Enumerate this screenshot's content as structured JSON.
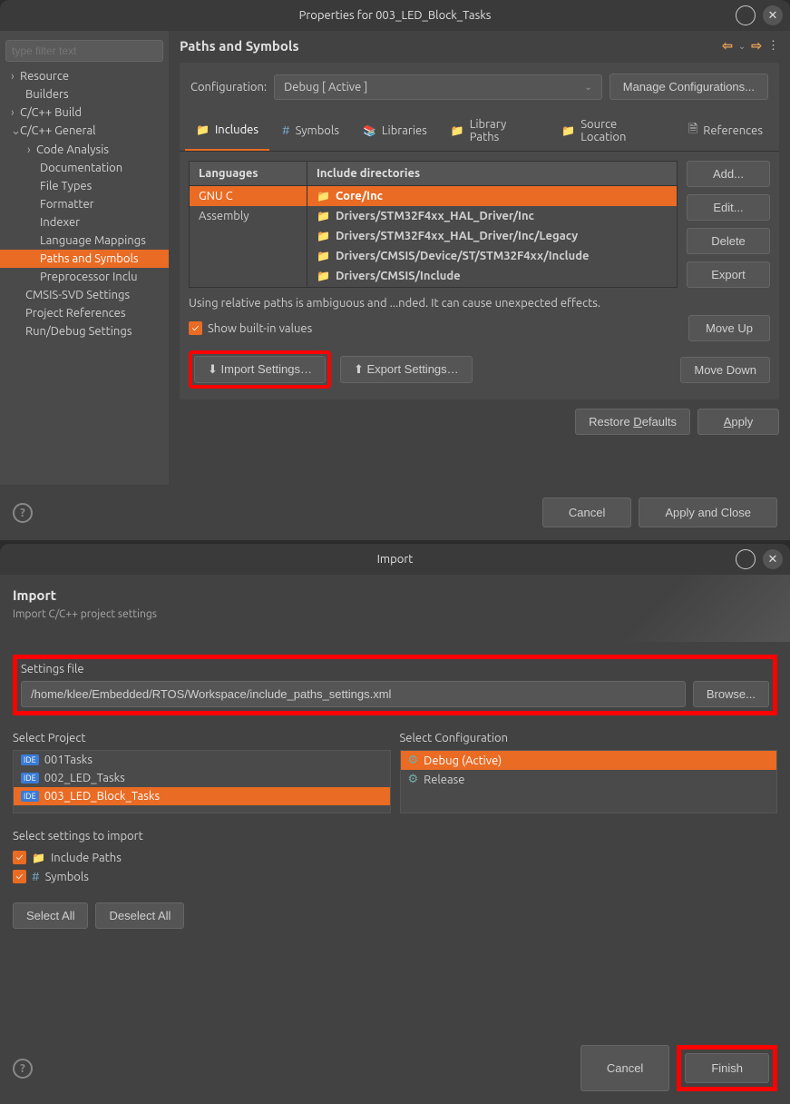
{
  "props": {
    "title": "Properties for 003_LED_Block_Tasks",
    "filter_placeholder": "type filter text",
    "tree": {
      "resource": "Resource",
      "builders": "Builders",
      "cbuild": "C/C++ Build",
      "cgeneral": "C/C++ General",
      "code_analysis": "Code Analysis",
      "documentation": "Documentation",
      "file_types": "File Types",
      "formatter": "Formatter",
      "indexer": "Indexer",
      "lang_mapping": "Language Mappings",
      "paths_symbols": "Paths and Symbols",
      "preproc": "Preprocessor Inclu",
      "cmsis": "CMSIS-SVD Settings",
      "proj_refs": "Project References",
      "rundebug": "Run/Debug Settings"
    },
    "section": "Paths and Symbols",
    "config_label": "Configuration:",
    "config_value": "Debug  [ Active ]",
    "manage_config": "Manage Configurations...",
    "tabs": {
      "includes": "Includes",
      "symbols": "Symbols",
      "libraries": "Libraries",
      "library_paths": "Library Paths",
      "source_location": "Source Location",
      "references": "References"
    },
    "table": {
      "lang_header": "Languages",
      "inc_header": "Include directories",
      "langs": [
        "GNU C",
        "Assembly"
      ],
      "includes": [
        "Core/Inc",
        "Drivers/STM32F4xx_HAL_Driver/Inc",
        "Drivers/STM32F4xx_HAL_Driver/Inc/Legacy",
        "Drivers/CMSIS/Device/ST/STM32F4xx/Include",
        "Drivers/CMSIS/Include"
      ]
    },
    "buttons": {
      "add": "Add...",
      "edit": "Edit...",
      "delete": "Delete",
      "export": "Export",
      "moveup": "Move Up",
      "movedown": "Move Down",
      "import_settings": "Import Settings…",
      "export_settings": "Export Settings…",
      "restore": "Restore Defaults",
      "apply": "Apply",
      "cancel": "Cancel",
      "apply_close": "Apply and Close"
    },
    "hint": "Using relative paths is ambiguous and ...nded. It can cause unexpected effects.",
    "show_builtin": "Show built-in values"
  },
  "import": {
    "title": "Import",
    "heading": "Import",
    "sub": "Import C/C++ project settings",
    "settings_file_label": "Settings file",
    "settings_file_value": "/home/klee/Embedded/RTOS/Workspace/include_paths_settings.xml",
    "browse": "Browse...",
    "select_project": "Select Project",
    "select_config": "Select Configuration",
    "projects": [
      "001Tasks",
      "002_LED_Tasks",
      "003_LED_Block_Tasks"
    ],
    "configs": [
      "Debug (Active)",
      "Release"
    ],
    "select_settings": "Select settings to import",
    "include_paths": "Include Paths",
    "symbols": "Symbols",
    "select_all": "Select All",
    "deselect_all": "Deselect All",
    "cancel": "Cancel",
    "finish": "Finish"
  }
}
